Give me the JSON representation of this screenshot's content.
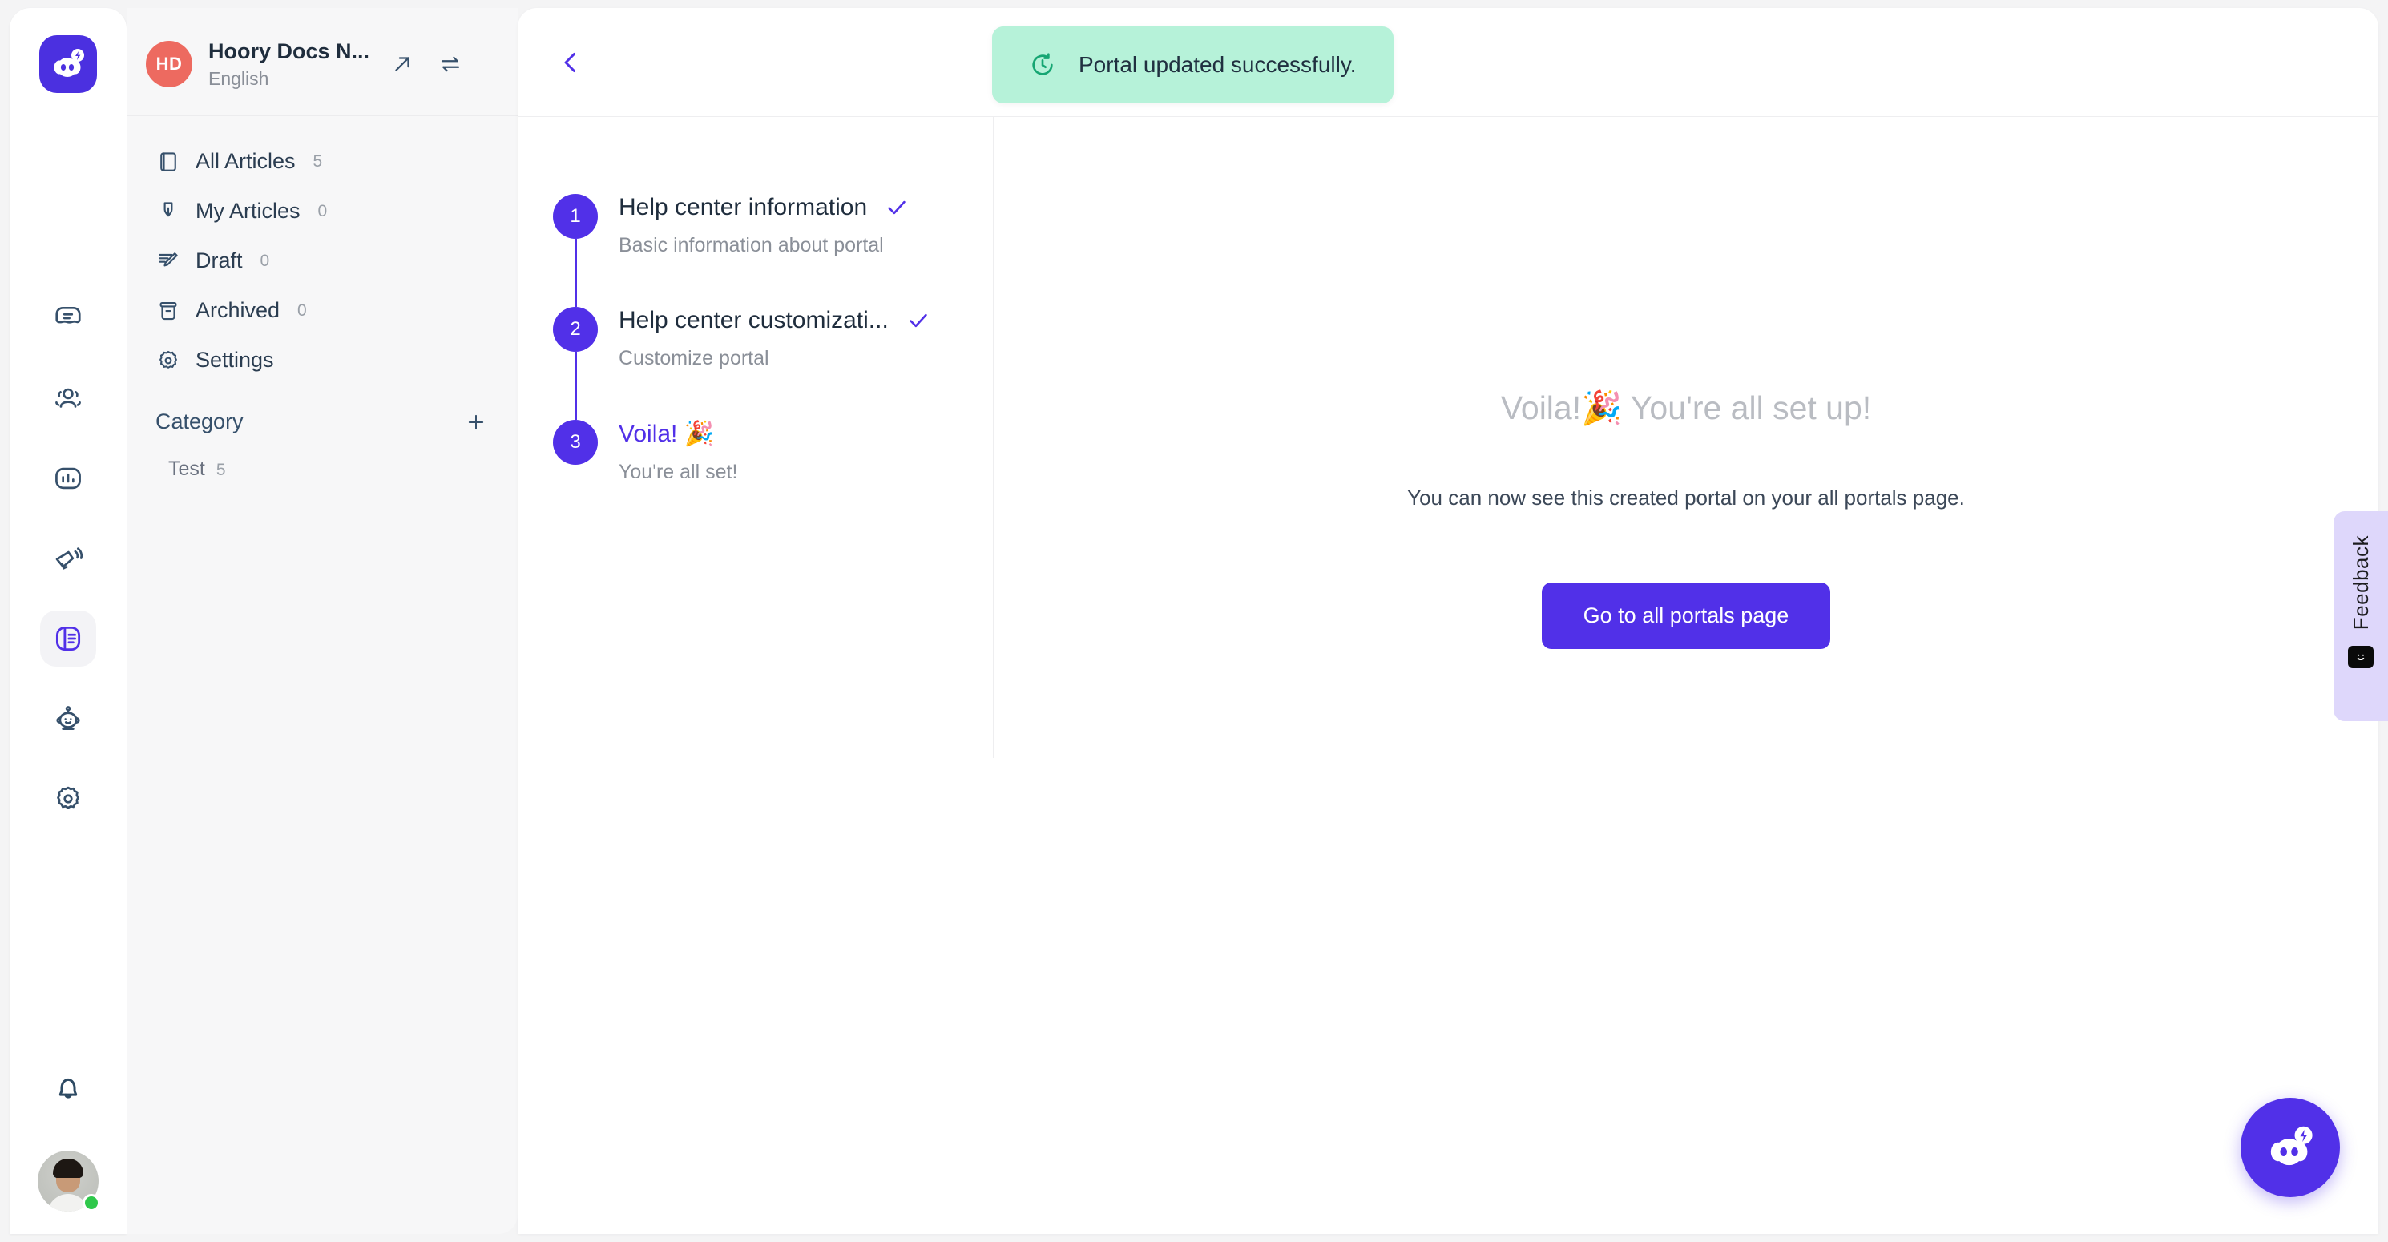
{
  "brand": {
    "name": "Hoory",
    "accent": "#5130e8",
    "logo_icon": "hoory-mascot-icon"
  },
  "rail": {
    "items": [
      {
        "name": "conversations",
        "icon": "conversations-icon",
        "active": false
      },
      {
        "name": "contacts",
        "icon": "contacts-icon",
        "active": false
      },
      {
        "name": "reports",
        "icon": "reports-bar-chart-icon",
        "active": false
      },
      {
        "name": "campaigns",
        "icon": "megaphone-icon",
        "active": false
      },
      {
        "name": "knowledge-base",
        "icon": "knowledge-base-icon",
        "active": true
      },
      {
        "name": "assistant",
        "icon": "robot-icon",
        "active": false
      },
      {
        "name": "settings",
        "icon": "gear-icon",
        "active": false
      }
    ],
    "bell_icon": "bell-icon",
    "avatar_icon": "user-avatar",
    "presence_color": "#2fc84b"
  },
  "sidebar": {
    "portal": {
      "initials": "HD",
      "initials_bg": "#ed6a60",
      "title": "Hoory Docs N...",
      "subtitle": "English",
      "open_icon": "external-link-arrow-icon",
      "switch_icon": "swap-portals-icon"
    },
    "items": [
      {
        "label": "All Articles",
        "count": "5",
        "icon": "book-icon"
      },
      {
        "label": "My Articles",
        "count": "0",
        "icon": "pen-nib-icon"
      },
      {
        "label": "Draft",
        "count": "0",
        "icon": "draft-pencil-icon"
      },
      {
        "label": "Archived",
        "count": "0",
        "icon": "archive-box-icon"
      },
      {
        "label": "Settings",
        "count": "",
        "icon": "gear-icon"
      }
    ],
    "category": {
      "title": "Category",
      "add_icon": "plus-icon",
      "entries": [
        {
          "name": "Test",
          "count": "5"
        }
      ]
    }
  },
  "main": {
    "back_icon": "chevron-left-icon",
    "steps": [
      {
        "number": "1",
        "title": "Help center information",
        "desc": "Basic information about portal",
        "completed": true,
        "current": false,
        "check_icon": "check-icon"
      },
      {
        "number": "2",
        "title": "Help center customizati...",
        "desc": "Customize portal",
        "completed": true,
        "current": false,
        "check_icon": "check-icon"
      },
      {
        "number": "3",
        "title": "Voila! 🎉",
        "desc": "You're all set!",
        "completed": false,
        "current": true,
        "check_icon": ""
      }
    ],
    "content": {
      "title": "Voila!🎉 You're all set up!",
      "subtitle": "You can now see this created portal on your all portals page.",
      "cta_label": "Go to all portals page"
    }
  },
  "toast": {
    "message": "Portal updated successfully.",
    "icon": "refresh-clock-icon",
    "bg": "#b6f2d9",
    "icon_color": "#16a673"
  },
  "feedback": {
    "label": "Feedback",
    "icon": "smiley-icon",
    "bg": "#ded7fb"
  },
  "fab": {
    "icon": "hoory-mascot-icon",
    "bg": "#5130e8"
  }
}
